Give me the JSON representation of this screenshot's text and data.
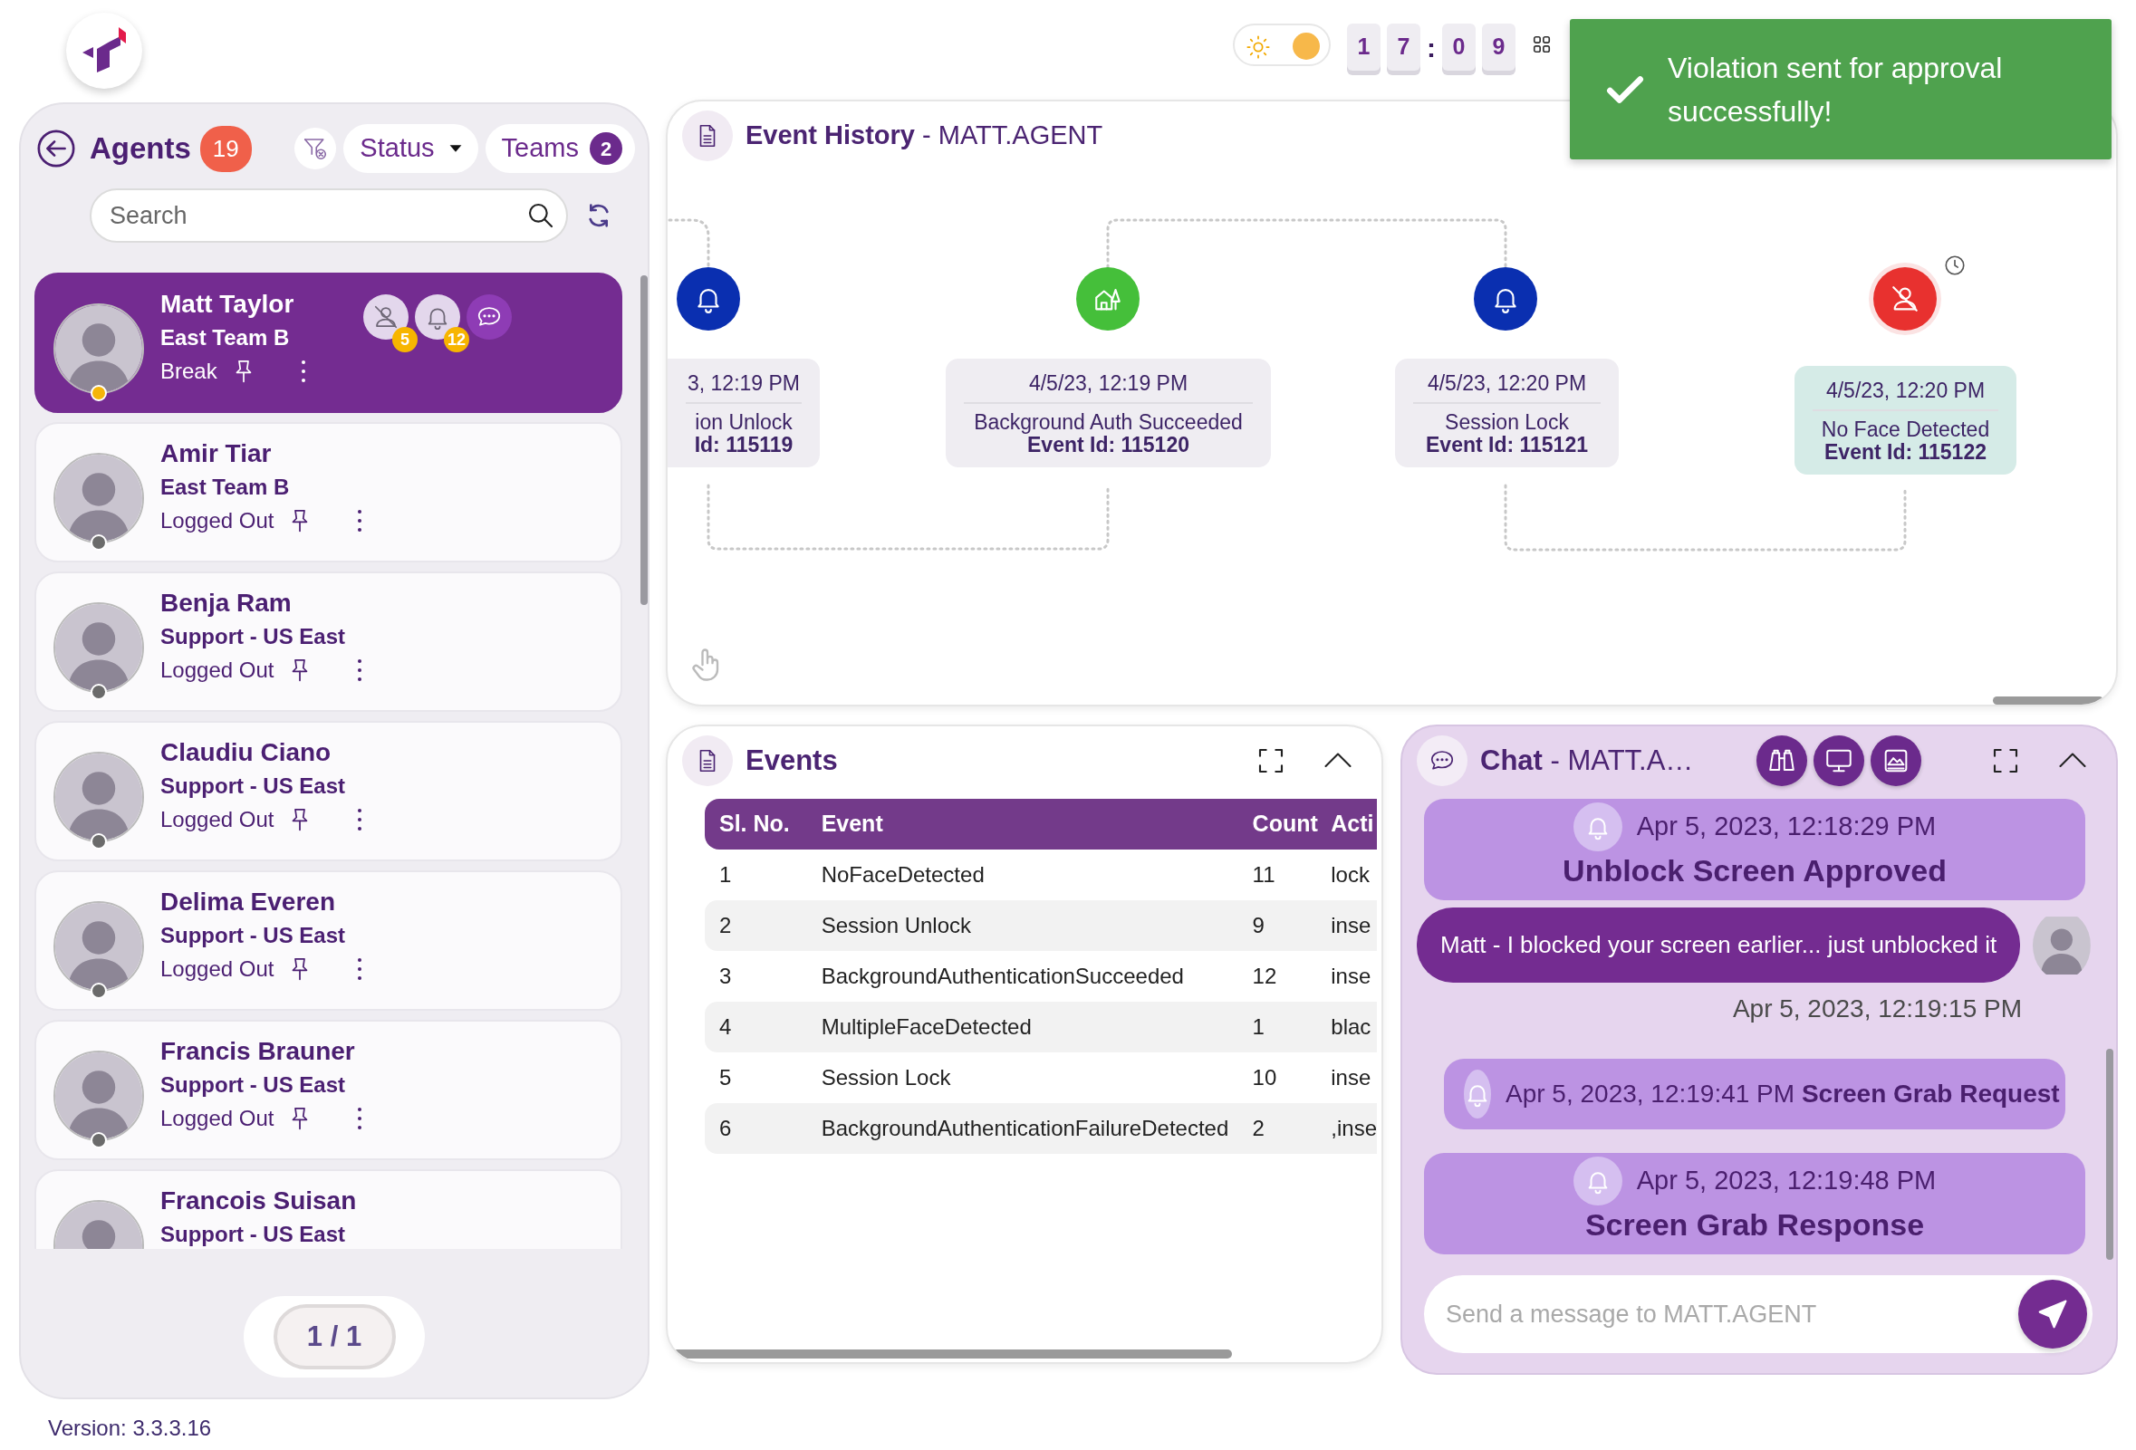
{
  "top_bar": {
    "theme_toggle": {
      "on": true
    },
    "clock": {
      "hours": [
        "1",
        "7"
      ],
      "separator": ":",
      "minutes": [
        "0",
        "9"
      ]
    }
  },
  "toast": {
    "message": "Violation sent for approval successfully!"
  },
  "agents_panel": {
    "title": "Agents",
    "count": "19",
    "status_filter": "Status",
    "teams": {
      "label": "Teams",
      "count": "2"
    },
    "search": {
      "placeholder": "Search"
    },
    "agents": [
      {
        "name": "Matt Taylor",
        "team": "East Team B",
        "status": "Break",
        "selected": true,
        "color": "#f5b50a",
        "alerts": [
          {
            "kind": "no-face",
            "count": "5"
          },
          {
            "kind": "bell",
            "count": "12"
          },
          {
            "kind": "chat"
          }
        ]
      },
      {
        "name": "Amir Tiar",
        "team": "East Team B",
        "status": "Logged Out",
        "selected": false,
        "color": "#6b6b6b"
      },
      {
        "name": "Benja Ram",
        "team": "Support - US East",
        "status": "Logged Out",
        "selected": false,
        "color": "#6b6b6b"
      },
      {
        "name": "Claudiu Ciano",
        "team": "Support - US East",
        "status": "Logged Out",
        "selected": false,
        "color": "#6b6b6b"
      },
      {
        "name": "Delima Everen",
        "team": "Support - US East",
        "status": "Logged Out",
        "selected": false,
        "color": "#6b6b6b"
      },
      {
        "name": "Francis Brauner",
        "team": "Support - US East",
        "status": "Logged Out",
        "selected": false,
        "color": "#6b6b6b"
      },
      {
        "name": "Francois Suisan",
        "team": "Support - US East",
        "selected": false
      }
    ],
    "pagination": "1 / 1"
  },
  "version": "Version: 3.3.3.16",
  "event_history": {
    "title": "**Event History** - MATT.AGENT",
    "events": [
      {
        "kind": "bell",
        "date": "3, 12:19 PM",
        "name": "ion Unlock",
        "event_id": "Id: 115119",
        "selected": false,
        "pending": false
      },
      {
        "kind": "auth",
        "date": "4/5/23, 12:19 PM",
        "name": "Background Auth Succeeded",
        "event_id": "Event Id: 115120",
        "selected": false,
        "pending": false
      },
      {
        "kind": "bell",
        "date": "4/5/23, 12:20 PM",
        "name": "Session Lock",
        "event_id": "Event Id: 115121",
        "selected": false,
        "pending": false
      },
      {
        "kind": "face",
        "date": "4/5/23, 12:20 PM",
        "name": "No Face Detected",
        "event_id": "Event Id: 115122",
        "selected": true,
        "pending": true
      }
    ]
  },
  "events_table": {
    "title": "Events",
    "columns": [
      "Sl. No.",
      "Event",
      "Count",
      "Acti"
    ],
    "rows": [
      [
        "1",
        "NoFaceDetected",
        "11",
        "lock"
      ],
      [
        "2",
        "Session Unlock",
        "9",
        "inse"
      ],
      [
        "3",
        "BackgroundAuthenticationSucceeded",
        "12",
        "inse"
      ],
      [
        "4",
        "MultipleFaceDetected",
        "1",
        "blac"
      ],
      [
        "5",
        "Session Lock",
        "10",
        "inse"
      ],
      [
        "6",
        "BackgroundAuthenticationFailureDetected",
        "2",
        ",inse"
      ]
    ]
  },
  "chat": {
    "title": "**Chat** - MATT.A…",
    "messages": [
      {
        "kind": "notice",
        "time": "Apr 5, 2023, 12:18:29 PM",
        "text": "Unblock Screen Approved"
      },
      {
        "kind": "bubble",
        "text": "Matt - I blocked your screen earlier... just unblocked it",
        "time": "Apr 5, 2023, 12:19:15 PM"
      },
      {
        "kind": "inline-notice",
        "time": "Apr 5, 2023, 12:19:41 PM",
        "text": "Screen Grab Request"
      },
      {
        "kind": "notice",
        "time": "Apr 5, 2023, 12:19:48 PM",
        "text": "Screen Grab Response"
      }
    ],
    "input": {
      "placeholder": "Send a message to MATT.AGENT"
    }
  }
}
